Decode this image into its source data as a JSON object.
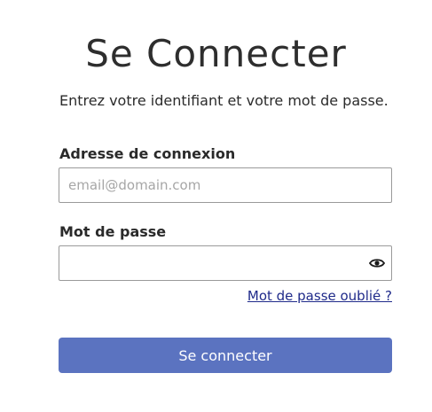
{
  "page": {
    "title": "Se Connecter",
    "instructions": "Entrez votre identifiant et votre mot de passe."
  },
  "form": {
    "email": {
      "label": "Adresse de connexion",
      "value": "",
      "placeholder": "email@domain.com"
    },
    "password": {
      "label": "Mot de passe",
      "value": "",
      "toggle_icon": "eye-icon"
    },
    "forgot_password_link": "Mot de passe oublié ?",
    "submit_label": "Se connecter"
  },
  "colors": {
    "primary_button": "#5b73c0",
    "link": "#1f2a8a",
    "input_border": "#9a9a9a"
  }
}
